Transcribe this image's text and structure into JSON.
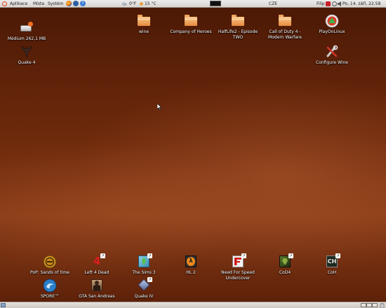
{
  "top_panel": {
    "menus": [
      "Aplikace",
      "Místa",
      "Systém"
    ],
    "weather": "0°F",
    "temperature": "15 °C",
    "keyboard_layout": "CZE",
    "user": "Filip",
    "datetime": "Po, 14. září, 22:58"
  },
  "desktop": {
    "left_icons": [
      {
        "label": "Médium 262,1 MB",
        "icon": "removable-drive-icon"
      },
      {
        "label": "Quake 4",
        "icon": "quake-logo-icon"
      }
    ],
    "folders": [
      {
        "label": "wine"
      },
      {
        "label": "Company of Heroes"
      },
      {
        "label": "HalfLife2 - Episode TWO"
      },
      {
        "label": "Call of Duty 4 - Modern Warfare"
      }
    ],
    "right_icons": [
      {
        "label": "PlayOnLinux",
        "icon": "playonlinux-icon"
      },
      {
        "label": "Configure Wine",
        "icon": "configure-wine-icon"
      }
    ],
    "games_row1": [
      {
        "label": "PoP: Sands of time"
      },
      {
        "label": "Left 4 Dead"
      },
      {
        "label": "The Sims 3"
      },
      {
        "label": "HL 2"
      },
      {
        "label": "Need For Speed Undercover"
      },
      {
        "label": "CoD4"
      },
      {
        "label": "CoH"
      }
    ],
    "games_row2": [
      {
        "label": "SPORE™"
      },
      {
        "label": "GTA San Andreas"
      },
      {
        "label": "Quake IV"
      }
    ]
  },
  "colors": {
    "accent": "#dd4814",
    "desktop": "#6e2a0c"
  }
}
